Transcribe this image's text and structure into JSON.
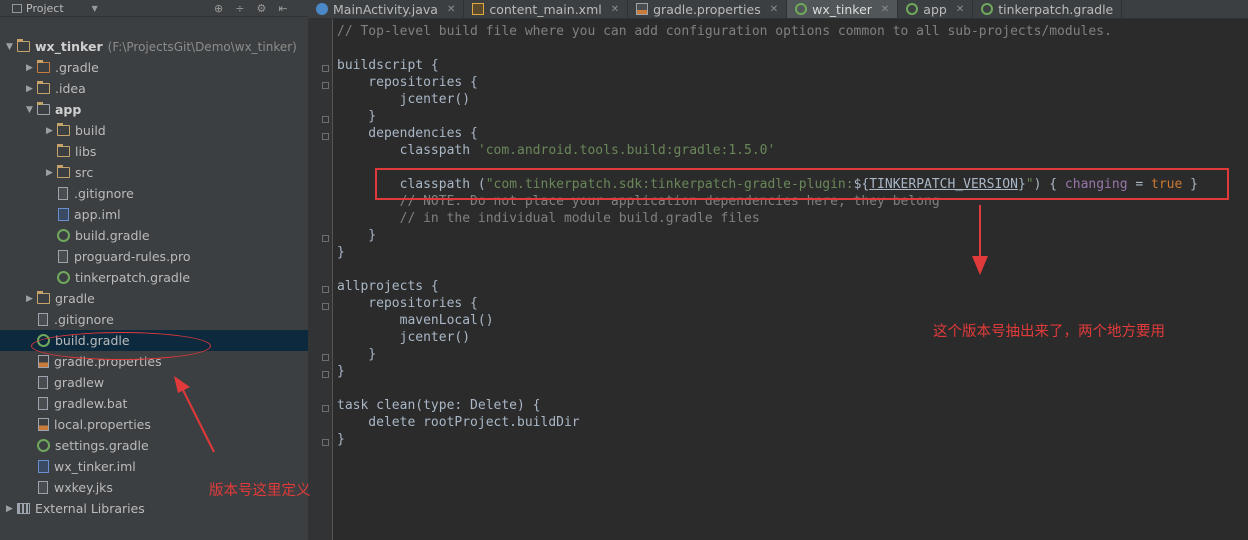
{
  "project_panel": {
    "header_label": "Project",
    "tree": [
      {
        "label": "wx_tinker",
        "suffix": "(F:\\ProjectsGit\\Demo\\wx_tinker)",
        "icon": "folder-icon",
        "expanded": true,
        "bold": true
      },
      {
        "label": ".gradle",
        "icon": "folder-icon",
        "expanded": false
      },
      {
        "label": ".idea",
        "icon": "folder-icon",
        "expanded": false
      },
      {
        "label": "app",
        "icon": "module-folder-icon",
        "expanded": true,
        "bold": true
      },
      {
        "label": "build",
        "icon": "folder-icon",
        "expanded": false
      },
      {
        "label": "libs",
        "icon": "folder-icon"
      },
      {
        "label": "src",
        "icon": "folder-icon",
        "expanded": false
      },
      {
        "label": ".gitignore",
        "icon": "text-file-icon"
      },
      {
        "label": "app.iml",
        "icon": "iml-file-icon"
      },
      {
        "label": "build.gradle",
        "icon": "gradle-icon"
      },
      {
        "label": "proguard-rules.pro",
        "icon": "text-file-icon"
      },
      {
        "label": "tinkerpatch.gradle",
        "icon": "gradle-icon"
      },
      {
        "label": "gradle",
        "icon": "folder-icon",
        "expanded": false
      },
      {
        "label": ".gitignore",
        "icon": "text-file-icon"
      },
      {
        "label": "build.gradle",
        "icon": "gradle-icon",
        "selected": true
      },
      {
        "label": "gradle.properties",
        "icon": "properties-file-icon"
      },
      {
        "label": "gradlew",
        "icon": "text-file-icon"
      },
      {
        "label": "gradlew.bat",
        "icon": "text-file-icon"
      },
      {
        "label": "local.properties",
        "icon": "properties-file-icon"
      },
      {
        "label": "settings.gradle",
        "icon": "gradle-icon"
      },
      {
        "label": "wx_tinker.iml",
        "icon": "iml-file-icon"
      },
      {
        "label": "wxkey.jks",
        "icon": "text-file-icon"
      },
      {
        "label": "External Libraries",
        "icon": "library-icon",
        "expanded": false
      }
    ]
  },
  "tabs": [
    {
      "label": "MainActivity.java",
      "icon": "class-icon"
    },
    {
      "label": "content_main.xml",
      "icon": "xml-file-icon"
    },
    {
      "label": "gradle.properties",
      "icon": "properties-file-icon"
    },
    {
      "label": "wx_tinker",
      "icon": "gradle-icon",
      "active": true
    },
    {
      "label": "app",
      "icon": "gradle-icon"
    },
    {
      "label": "tinkerpatch.gradle",
      "icon": "gradle-icon"
    }
  ],
  "code_lines": [
    "// Top-level build file where you can add configuration options common to all sub-projects/modules.",
    "",
    "buildscript {",
    "    repositories {",
    "        jcenter()",
    "    }",
    "    dependencies {",
    "        classpath 'com.android.tools.build:gradle:1.5.0'",
    "",
    "        classpath (\"com.tinkerpatch.sdk:tinkerpatch-gradle-plugin:${TINKERPATCH_VERSION}\") { changing = true }",
    "        // NOTE: Do not place your application dependencies here; they belong",
    "        // in the individual module build.gradle files",
    "    }",
    "}",
    "",
    "allprojects {",
    "    repositories {",
    "        mavenLocal()",
    "        jcenter()",
    "    }",
    "}",
    "",
    "task clean(type: Delete) {",
    "    delete rootProject.buildDir",
    "}"
  ],
  "annotations": {
    "editor_note": "这个版本号抽出来了，两个地方要用",
    "tree_note": "版本号这里定义"
  },
  "colors": {
    "annotation_red": "#e03a3a",
    "selection": "#0d293e",
    "background": "#2b2b2b",
    "panel": "#3c3f41"
  }
}
